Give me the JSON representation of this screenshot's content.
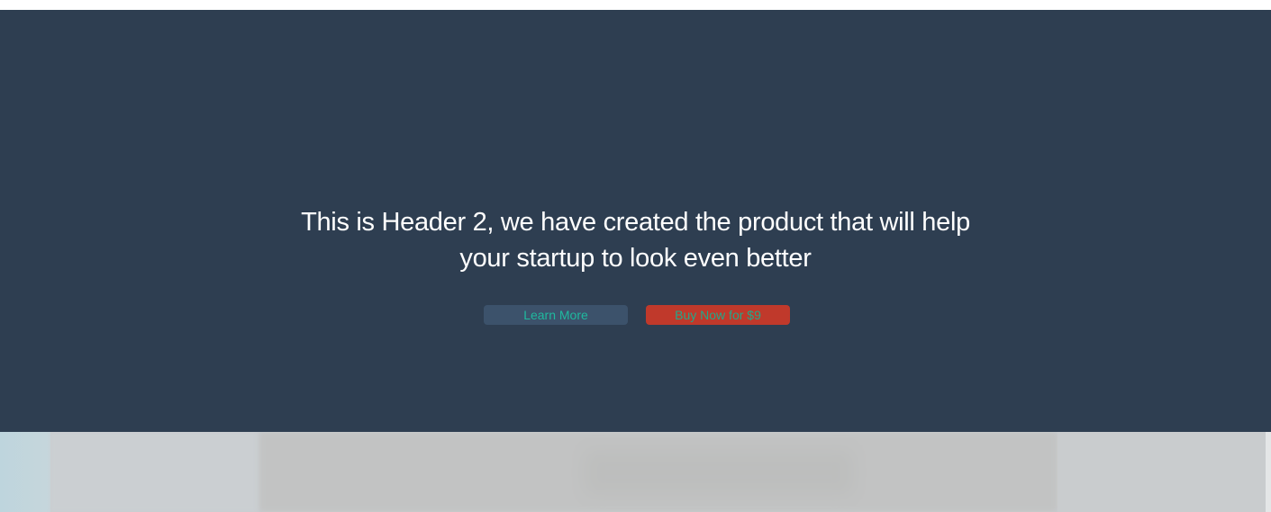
{
  "hero": {
    "title_line1": "This is Header 2, we have created the product that will help",
    "title_line2": "your startup to look even better",
    "learn_more_label": "Learn More",
    "buy_now_label": "Buy Now for $9",
    "background_color": "#2e3e51",
    "learn_more_color": "#3c526b",
    "buy_now_color": "#c0392b",
    "button_text_color": "#1fb99f"
  }
}
